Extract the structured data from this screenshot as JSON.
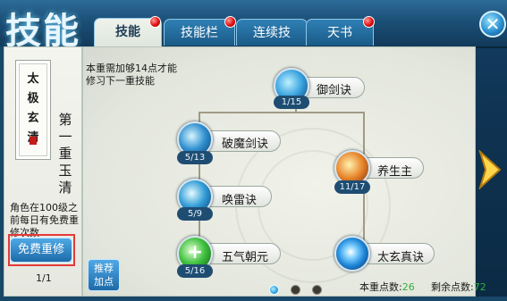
{
  "header": {
    "title": "技能",
    "tabs": [
      {
        "label": "技能",
        "active": true,
        "badge": true
      },
      {
        "label": "技能栏",
        "active": false,
        "badge": true
      },
      {
        "label": "连续技",
        "active": false,
        "badge": false
      },
      {
        "label": "天书",
        "active": false,
        "badge": true
      }
    ],
    "close_icon": "close-icon"
  },
  "left_panel": {
    "scroll_title": "太极玄清道",
    "stage_label": "第一重玉清",
    "description": "角色在100级之前每日有免费重修次数",
    "free_reset_button": "免费重修",
    "free_count": "1/1"
  },
  "main_panel": {
    "requirement_text": "本重需加够14点才能修习下一重技能",
    "skills": [
      {
        "name": "御剑诀",
        "level": "1/15",
        "icon": "sword-icon",
        "color": "#3aa3e0"
      },
      {
        "name": "破魔剑诀",
        "level": "5/13",
        "icon": "blade-icon",
        "color": "#2f8fcf"
      },
      {
        "name": "养生主",
        "level": "11/17",
        "icon": "flame-icon",
        "color": "#e8842a"
      },
      {
        "name": "唤雷诀",
        "level": "5/9",
        "icon": "lightning-icon",
        "color": "#2f9bd6"
      },
      {
        "name": "五气朝元",
        "level": "5/16",
        "icon": "heal-plus-icon",
        "color": "#3cbf3c"
      },
      {
        "name": "太玄真诀",
        "level": "",
        "icon": "orb-icon",
        "color": "#1e86d8"
      }
    ],
    "recommend_button": "推荐加点",
    "current_points_label": "本重点数:",
    "current_points_value": "26",
    "remaining_points_label": "剩余点数:",
    "remaining_points_value": "72",
    "page_dots": 3,
    "active_page": 1
  },
  "colors": {
    "accent": "#1d6aa8",
    "badge": "#e01010",
    "points_green": "#2fb23a"
  }
}
